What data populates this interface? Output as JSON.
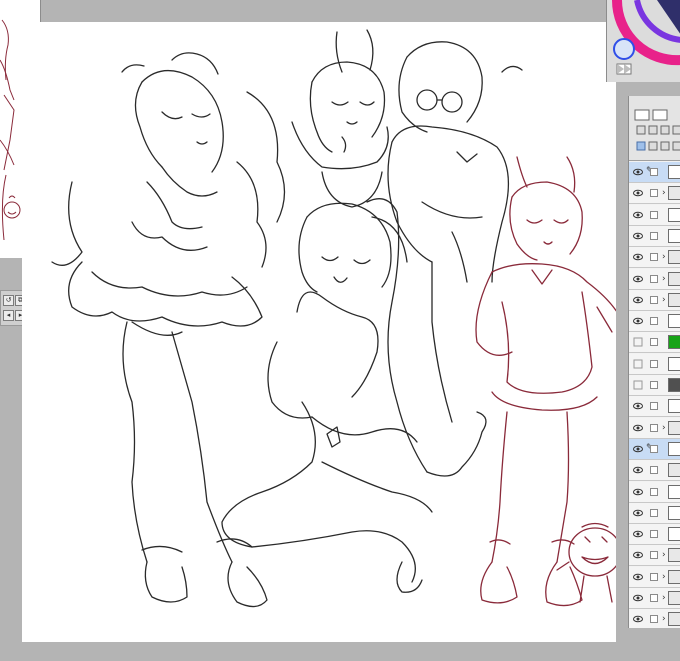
{
  "app": {
    "title": ""
  },
  "colors": {
    "workspace": "#b4b4b4",
    "canvas_bg": "#ffffff",
    "line_black": "#2a2a2a",
    "line_maroon": "#8a2a3a",
    "selected_layer": "#c8dcf5",
    "layer_green": "#17a317",
    "layer_dark": "#505050"
  },
  "canvas": {
    "characters": [
      "maid-girl",
      "bunny-ear-girl",
      "glasses-hoodie-girl",
      "crouching-twin-tail-girl",
      "cat-ear-girl",
      "tomato-mascot"
    ]
  },
  "color_panel": {
    "current_color": "#d8e4f8",
    "ring_colors": [
      "#e8228a",
      "#7a36e0",
      "#2f4ee8"
    ]
  },
  "layers": [
    {
      "visible": true,
      "pen": true,
      "folder": false,
      "selected": true,
      "thumb": "white"
    },
    {
      "visible": true,
      "pen": false,
      "folder": true,
      "selected": false,
      "thumb": "folder"
    },
    {
      "visible": true,
      "pen": false,
      "folder": false,
      "selected": false,
      "thumb": "white"
    },
    {
      "visible": true,
      "pen": false,
      "folder": false,
      "selected": false,
      "thumb": "white"
    },
    {
      "visible": true,
      "pen": false,
      "folder": true,
      "selected": false,
      "thumb": "folder"
    },
    {
      "visible": true,
      "pen": false,
      "folder": true,
      "selected": false,
      "thumb": "folder"
    },
    {
      "visible": true,
      "pen": false,
      "folder": true,
      "selected": false,
      "thumb": "folder"
    },
    {
      "visible": true,
      "pen": false,
      "folder": false,
      "selected": false,
      "thumb": "white"
    },
    {
      "visible": false,
      "pen": false,
      "folder": false,
      "selected": false,
      "thumb": "green"
    },
    {
      "visible": false,
      "pen": false,
      "folder": false,
      "selected": false,
      "thumb": "white"
    },
    {
      "visible": false,
      "pen": false,
      "folder": false,
      "selected": false,
      "thumb": "dark"
    },
    {
      "visible": true,
      "pen": false,
      "folder": false,
      "selected": false,
      "thumb": "white"
    },
    {
      "visible": true,
      "pen": false,
      "folder": true,
      "selected": false,
      "thumb": "folder"
    },
    {
      "visible": true,
      "pen": true,
      "folder": false,
      "selected": true,
      "thumb": "white"
    },
    {
      "visible": true,
      "pen": false,
      "folder": false,
      "selected": false,
      "thumb": "folder"
    },
    {
      "visible": true,
      "pen": false,
      "folder": false,
      "selected": false,
      "thumb": "white"
    },
    {
      "visible": true,
      "pen": false,
      "folder": false,
      "selected": false,
      "thumb": "white"
    },
    {
      "visible": true,
      "pen": false,
      "folder": false,
      "selected": false,
      "thumb": "white"
    },
    {
      "visible": true,
      "pen": false,
      "folder": true,
      "selected": false,
      "thumb": "folder"
    },
    {
      "visible": true,
      "pen": false,
      "folder": true,
      "selected": false,
      "thumb": "folder"
    },
    {
      "visible": true,
      "pen": false,
      "folder": true,
      "selected": false,
      "thumb": "folder"
    },
    {
      "visible": true,
      "pen": false,
      "folder": true,
      "selected": false,
      "thumb": "folder"
    }
  ]
}
